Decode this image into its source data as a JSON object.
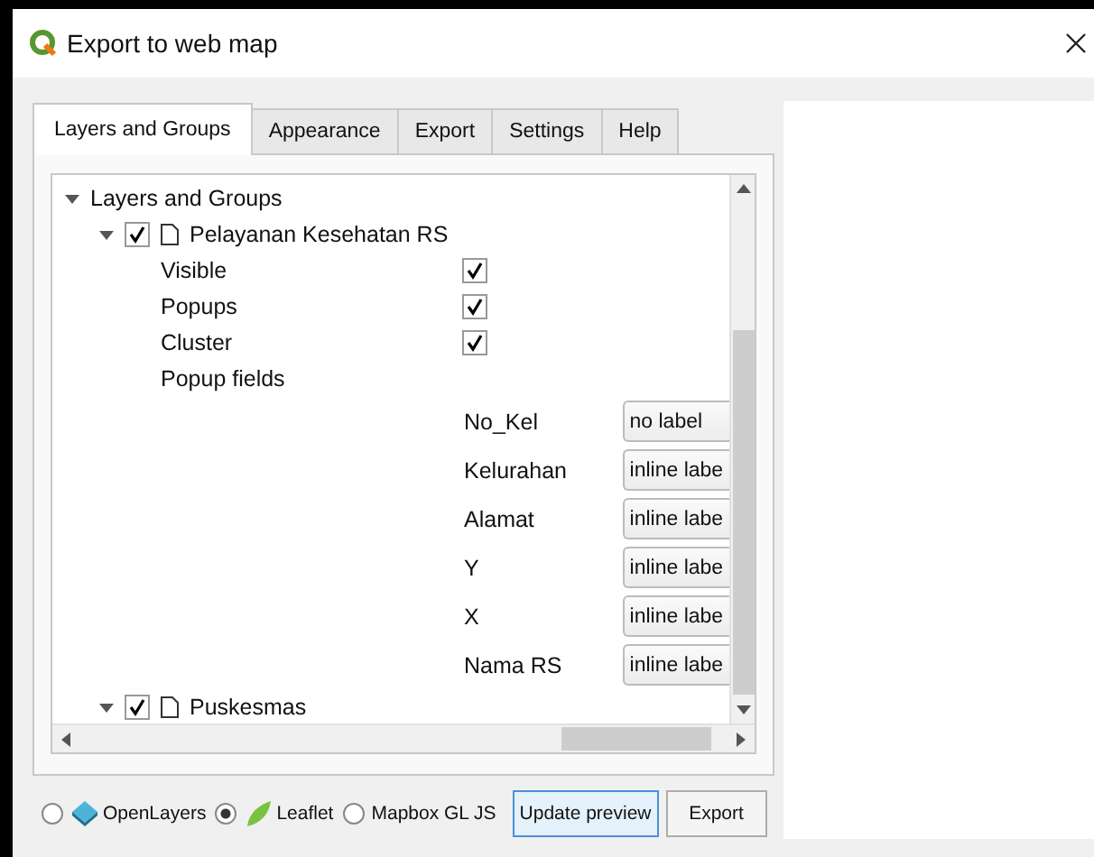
{
  "window": {
    "title": "Export to web map"
  },
  "tabs": [
    {
      "label": "Layers and Groups",
      "selected": true
    },
    {
      "label": "Appearance",
      "selected": false
    },
    {
      "label": "Export",
      "selected": false
    },
    {
      "label": "Settings",
      "selected": false
    },
    {
      "label": "Help",
      "selected": false
    }
  ],
  "tree": {
    "label": "Layers and Groups",
    "expanded": true,
    "children": [
      {
        "label": "Pelayanan Kesehatan RS",
        "checked": true,
        "expanded": true,
        "options": [
          {
            "label": "Visible",
            "checked": true
          },
          {
            "label": "Popups",
            "checked": true
          },
          {
            "label": "Cluster",
            "checked": true
          }
        ],
        "popup_fields_label": "Popup fields",
        "popup_fields": [
          {
            "name": "No_Kel",
            "value": "no label"
          },
          {
            "name": "Kelurahan",
            "value": "inline labe"
          },
          {
            "name": "Alamat",
            "value": "inline labe"
          },
          {
            "name": "Y",
            "value": "inline labe"
          },
          {
            "name": "X",
            "value": "inline labe"
          },
          {
            "name": "Nama RS",
            "value": "inline labe"
          }
        ]
      },
      {
        "label": "Puskesmas",
        "checked": true,
        "expanded": true
      }
    ]
  },
  "renderers": [
    {
      "kind": "openlayers",
      "label": "OpenLayers",
      "selected": false
    },
    {
      "kind": "leaflet",
      "label": "Leaflet",
      "selected": true
    },
    {
      "kind": "mapbox",
      "label": "Mapbox GL JS",
      "selected": false
    }
  ],
  "buttons": [
    {
      "label": "Update preview",
      "focused": true
    },
    {
      "label": "Export",
      "focused": false
    }
  ]
}
